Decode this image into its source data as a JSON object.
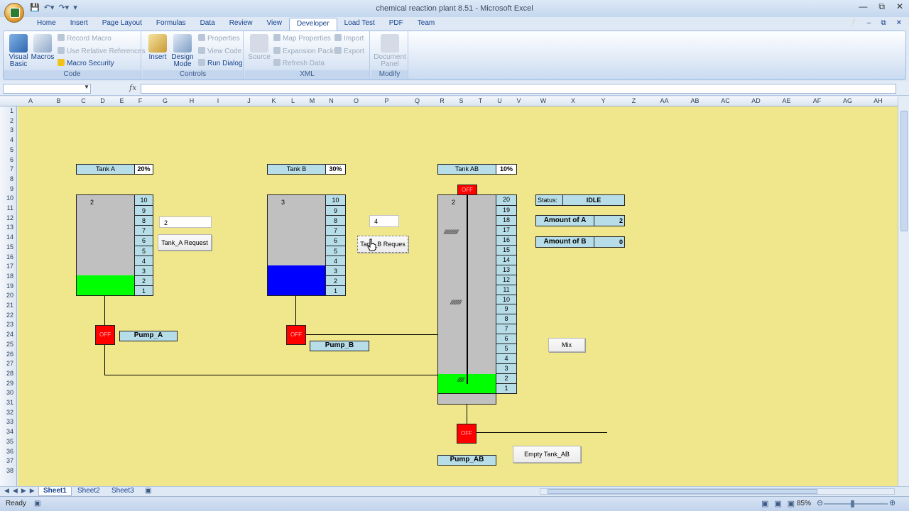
{
  "window": {
    "title": "chemical reaction plant 8.51 - Microsoft Excel"
  },
  "ribbon": {
    "tabs": [
      "Home",
      "Insert",
      "Page Layout",
      "Formulas",
      "Data",
      "Review",
      "View",
      "Developer",
      "Load Test",
      "PDF",
      "Team"
    ],
    "active_tab": "Developer",
    "code": {
      "label": "Code",
      "visual_basic": "Visual Basic",
      "macros": "Macros",
      "record_macro": "Record Macro",
      "use_relative": "Use Relative References",
      "macro_security": "Macro Security"
    },
    "controls": {
      "label": "Controls",
      "insert": "Insert",
      "design_mode": "Design Mode",
      "properties": "Properties",
      "view_code": "View Code",
      "run_dialog": "Run Dialog"
    },
    "xml": {
      "label": "XML",
      "source": "Source",
      "map_properties": "Map Properties",
      "expansion_packs": "Expansion Packs",
      "refresh_data": "Refresh Data",
      "import": "Import",
      "export": "Export"
    },
    "modify": {
      "label": "Modify",
      "document_panel": "Document Panel"
    }
  },
  "formula_bar": {
    "name_box": "",
    "fx": "fx",
    "formula": ""
  },
  "grid": {
    "columns": [
      "A",
      "B",
      "C",
      "D",
      "E",
      "F",
      "G",
      "H",
      "I",
      "J",
      "K",
      "L",
      "M",
      "N",
      "O",
      "P",
      "Q",
      "R",
      "S",
      "T",
      "U",
      "V",
      "W",
      "X",
      "Y",
      "Z",
      "AA",
      "AB",
      "AC",
      "AD",
      "AE",
      "AF",
      "AG",
      "AH"
    ],
    "rows": [
      "1",
      "2",
      "3",
      "4",
      "5",
      "6",
      "7",
      "8",
      "9",
      "10",
      "11",
      "12",
      "13",
      "14",
      "15",
      "16",
      "17",
      "18",
      "19",
      "20",
      "21",
      "22",
      "23",
      "24",
      "25",
      "26",
      "27",
      "28",
      "29",
      "30",
      "31",
      "32",
      "33",
      "34",
      "35",
      "36",
      "37",
      "38"
    ]
  },
  "plant": {
    "tank_a": {
      "label": "Tank A",
      "percent": "20%",
      "inner": "2",
      "scale": [
        "10",
        "9",
        "8",
        "7",
        "6",
        "5",
        "4",
        "3",
        "2",
        "1"
      ],
      "level": 0.2,
      "color": "#00ff00"
    },
    "tank_b": {
      "label": "Tank B",
      "percent": "30%",
      "inner": "3",
      "scale": [
        "10",
        "9",
        "8",
        "7",
        "6",
        "5",
        "4",
        "3",
        "2",
        "1"
      ],
      "level": 0.3,
      "color": "#0000ff"
    },
    "tank_ab": {
      "label": "Tank AB",
      "percent": "10%",
      "inner": "2",
      "scale": [
        "20",
        "19",
        "18",
        "17",
        "16",
        "15",
        "14",
        "13",
        "12",
        "11",
        "10",
        "9",
        "8",
        "7",
        "6",
        "5",
        "4",
        "3",
        "2",
        "1"
      ],
      "level": 0.1,
      "color": "#00ff00",
      "hatch1": "/////////////",
      "hatch2": "//////////",
      "hatch3": "//////"
    },
    "tank_a_input": "2",
    "tank_b_input": "4",
    "tank_a_request": "Tank_A Request",
    "tank_b_request": "Tank_B Reques",
    "pump_a": "Pump_A",
    "pump_b": "Pump_B",
    "pump_ab": "Pump_AB",
    "valve_text": "OFF",
    "status_label": "Status:",
    "status_value": "IDLE",
    "amount_a_label": "Amount of A",
    "amount_a_value": "2",
    "amount_b_label": "Amount of B",
    "amount_b_value": "0",
    "mix": "Mix",
    "empty_tank_ab": "Empty Tank_AB"
  },
  "sheets": [
    "Sheet1",
    "Sheet2",
    "Sheet3"
  ],
  "active_sheet": "Sheet1",
  "status_bar": {
    "ready": "Ready",
    "zoom": "85%"
  }
}
